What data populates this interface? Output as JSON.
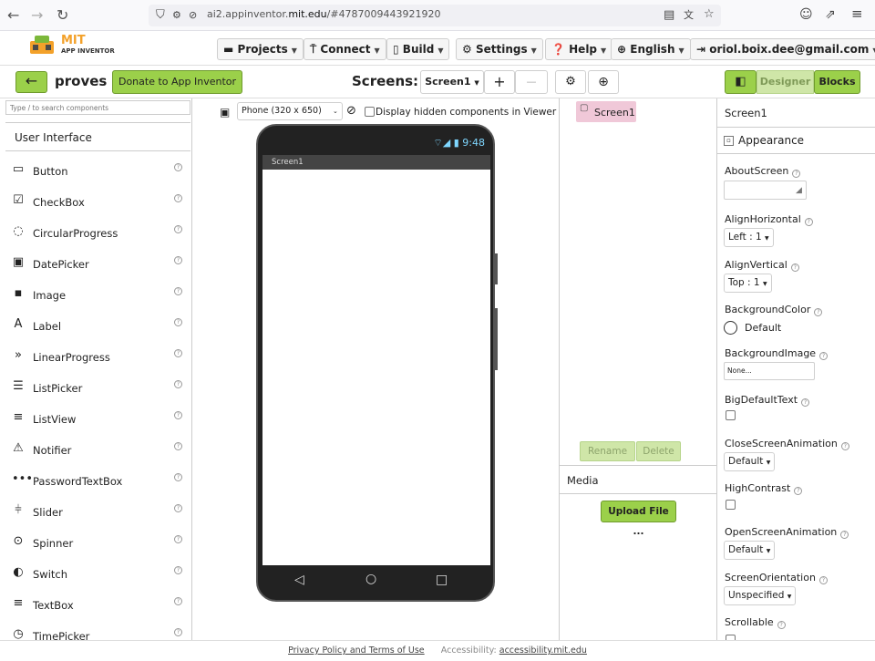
{
  "browser": {
    "url_prefix": "ai2.appinventor.",
    "url_domain": "mit.edu",
    "url_suffix": "/#4787009443921920",
    "back_icon": "arrow-left-icon",
    "forward_icon": "arrow-right-icon",
    "reload_icon": "reload-icon"
  },
  "topmenu": {
    "logo_line1": "MIT",
    "logo_line2": "APP INVENTOR",
    "projects": "Projects",
    "connect": "Connect",
    "build": "Build",
    "settings": "Settings",
    "help": "Help",
    "language": "English",
    "account": "oriol.boix.dee@gmail.com"
  },
  "toolbar": {
    "project_name": "proves",
    "donate": "Donate to App Inventor",
    "screens_label": "Screens:",
    "screen_select": "Screen1",
    "add": "+",
    "remove": "—",
    "designer": "Designer",
    "blocks": "Blocks"
  },
  "palette": {
    "search_placeholder": "Type / to search components",
    "category": "User Interface",
    "items": [
      {
        "label": "Button",
        "icon": "button-icon",
        "glyph": "▭"
      },
      {
        "label": "CheckBox",
        "icon": "checkbox-icon",
        "glyph": "☑"
      },
      {
        "label": "CircularProgress",
        "icon": "circular-progress-icon",
        "glyph": "◌"
      },
      {
        "label": "DatePicker",
        "icon": "calendar-icon",
        "glyph": "▣"
      },
      {
        "label": "Image",
        "icon": "image-icon",
        "glyph": "▪"
      },
      {
        "label": "Label",
        "icon": "label-icon",
        "glyph": "A"
      },
      {
        "label": "LinearProgress",
        "icon": "linear-progress-icon",
        "glyph": "»"
      },
      {
        "label": "ListPicker",
        "icon": "list-picker-icon",
        "glyph": "☰"
      },
      {
        "label": "ListView",
        "icon": "list-view-icon",
        "glyph": "≡"
      },
      {
        "label": "Notifier",
        "icon": "warning-icon",
        "glyph": "⚠"
      },
      {
        "label": "PasswordTextBox",
        "icon": "password-icon",
        "glyph": "•••"
      },
      {
        "label": "Slider",
        "icon": "slider-icon",
        "glyph": "⫩"
      },
      {
        "label": "Spinner",
        "icon": "spinner-icon",
        "glyph": "⊙"
      },
      {
        "label": "Switch",
        "icon": "switch-icon",
        "glyph": "◐"
      },
      {
        "label": "TextBox",
        "icon": "textbox-icon",
        "glyph": "≡"
      },
      {
        "label": "TimePicker",
        "icon": "clock-icon",
        "glyph": "◷"
      }
    ]
  },
  "viewer": {
    "device": "Phone (320 x 650)",
    "hidden_label": "Display hidden components in Viewer",
    "clock": "9:48",
    "screen_title": "Screen1"
  },
  "components": {
    "tree_item": "Screen1",
    "rename": "Rename",
    "delete": "Delete",
    "media_title": "Media",
    "upload": "Upload File ..."
  },
  "properties": {
    "title": "Screen1",
    "section": "Appearance",
    "about_screen": "AboutScreen",
    "align_horizontal": "AlignHorizontal",
    "align_horizontal_value": "Left : 1",
    "align_vertical": "AlignVertical",
    "align_vertical_value": "Top : 1",
    "background_color": "BackgroundColor",
    "background_color_value": "Default",
    "background_image": "BackgroundImage",
    "background_image_value": "None...",
    "big_default_text": "BigDefaultText",
    "close_anim": "CloseScreenAnimation",
    "close_anim_value": "Default",
    "high_contrast": "HighContrast",
    "open_anim": "OpenScreenAnimation",
    "open_anim_value": "Default",
    "orientation": "ScreenOrientation",
    "orientation_value": "Unspecified",
    "scrollable": "Scrollable"
  },
  "footer": {
    "privacy": "Privacy Policy and Terms of Use",
    "accessibility_label": "Accessibility:",
    "accessibility_link": "accessibility.mit.edu"
  },
  "colors": {
    "green": "#9bd04a",
    "green_border": "#6e9a2c",
    "selected_component": "#f0c8d8"
  }
}
